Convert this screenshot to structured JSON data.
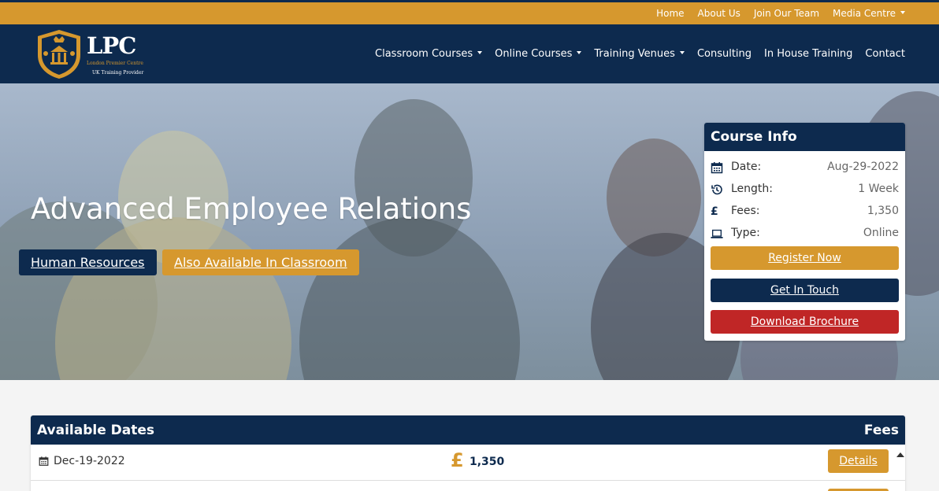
{
  "topbar": {
    "links": [
      {
        "label": "Home"
      },
      {
        "label": "About Us"
      },
      {
        "label": "Join Our Team"
      },
      {
        "label": "Media Centre"
      }
    ]
  },
  "brand": {
    "name": "LPC",
    "full_name": "London Premier Centre",
    "tagline": "UK Training Provider"
  },
  "nav": {
    "items": [
      {
        "label": "Classroom Courses"
      },
      {
        "label": "Online Courses"
      },
      {
        "label": "Training Venues"
      },
      {
        "label": "Consulting"
      },
      {
        "label": "In House Training"
      },
      {
        "label": "Contact"
      }
    ]
  },
  "hero": {
    "title": "Advanced Employee Relations",
    "category": "Human Resources",
    "availability": "Also Available In Classroom"
  },
  "course_info": {
    "title": "Course Info",
    "rows": [
      {
        "label": "Date:",
        "value": "Aug-29-2022",
        "icon": "calendar-icon"
      },
      {
        "label": "Length:",
        "value": "1 Week",
        "icon": "history-icon"
      },
      {
        "label": "Fees:",
        "value": "1,350",
        "icon": "pound-icon"
      },
      {
        "label": "Type:",
        "value": "Online",
        "icon": "laptop-icon"
      }
    ],
    "register_label": "Register Now",
    "contact_label": "Get In Touch",
    "brochure_label": "Download Brochure"
  },
  "available_dates": {
    "title": "Available Dates",
    "fees_header": "Fees",
    "rows": [
      {
        "date": "Dec-19-2022",
        "currency": "£",
        "fee": "1,350",
        "action": "Details"
      }
    ]
  },
  "colors": {
    "navy": "#0d2a4e",
    "gold": "#d6982e",
    "red": "#c02626"
  }
}
